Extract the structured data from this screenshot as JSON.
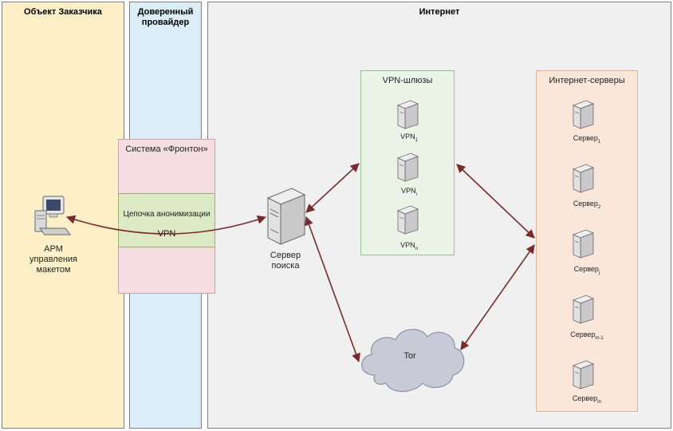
{
  "zones": {
    "customer": "Объект Заказчика",
    "provider": "Доверенный провайдер",
    "internet": "Интернет"
  },
  "frontone": {
    "title": "Система «Фронтон»",
    "chain_label": "Цепочка анонимизации",
    "vpn_label": "VPN"
  },
  "workstation": {
    "label_lines": [
      "АРМ",
      "управления",
      "макетом"
    ]
  },
  "search_server": {
    "label_lines": [
      "Сервер",
      "поиска"
    ]
  },
  "vpn_gateways": {
    "title": "VPN-шлюзы",
    "items": [
      {
        "base": "VPN",
        "sub": "1"
      },
      {
        "base": "VPN",
        "sub": "i"
      },
      {
        "base": "VPN",
        "sub": "n"
      }
    ]
  },
  "internet_servers": {
    "title": "Интернет-серверы",
    "items": [
      {
        "base": "Сервер",
        "sub": "1"
      },
      {
        "base": "Сервер",
        "sub": "2"
      },
      {
        "base": "Сервер",
        "sub": "j"
      },
      {
        "base": "Сервер",
        "sub": "m-1"
      },
      {
        "base": "Сервер",
        "sub": "m"
      }
    ]
  },
  "tor": {
    "label": "Tor"
  },
  "colors": {
    "arrow": "#7a2a2a",
    "customer_bg": "#fdf0c8",
    "provider_bg": "#dbeef7",
    "internet_bg": "#f0f0f0"
  }
}
